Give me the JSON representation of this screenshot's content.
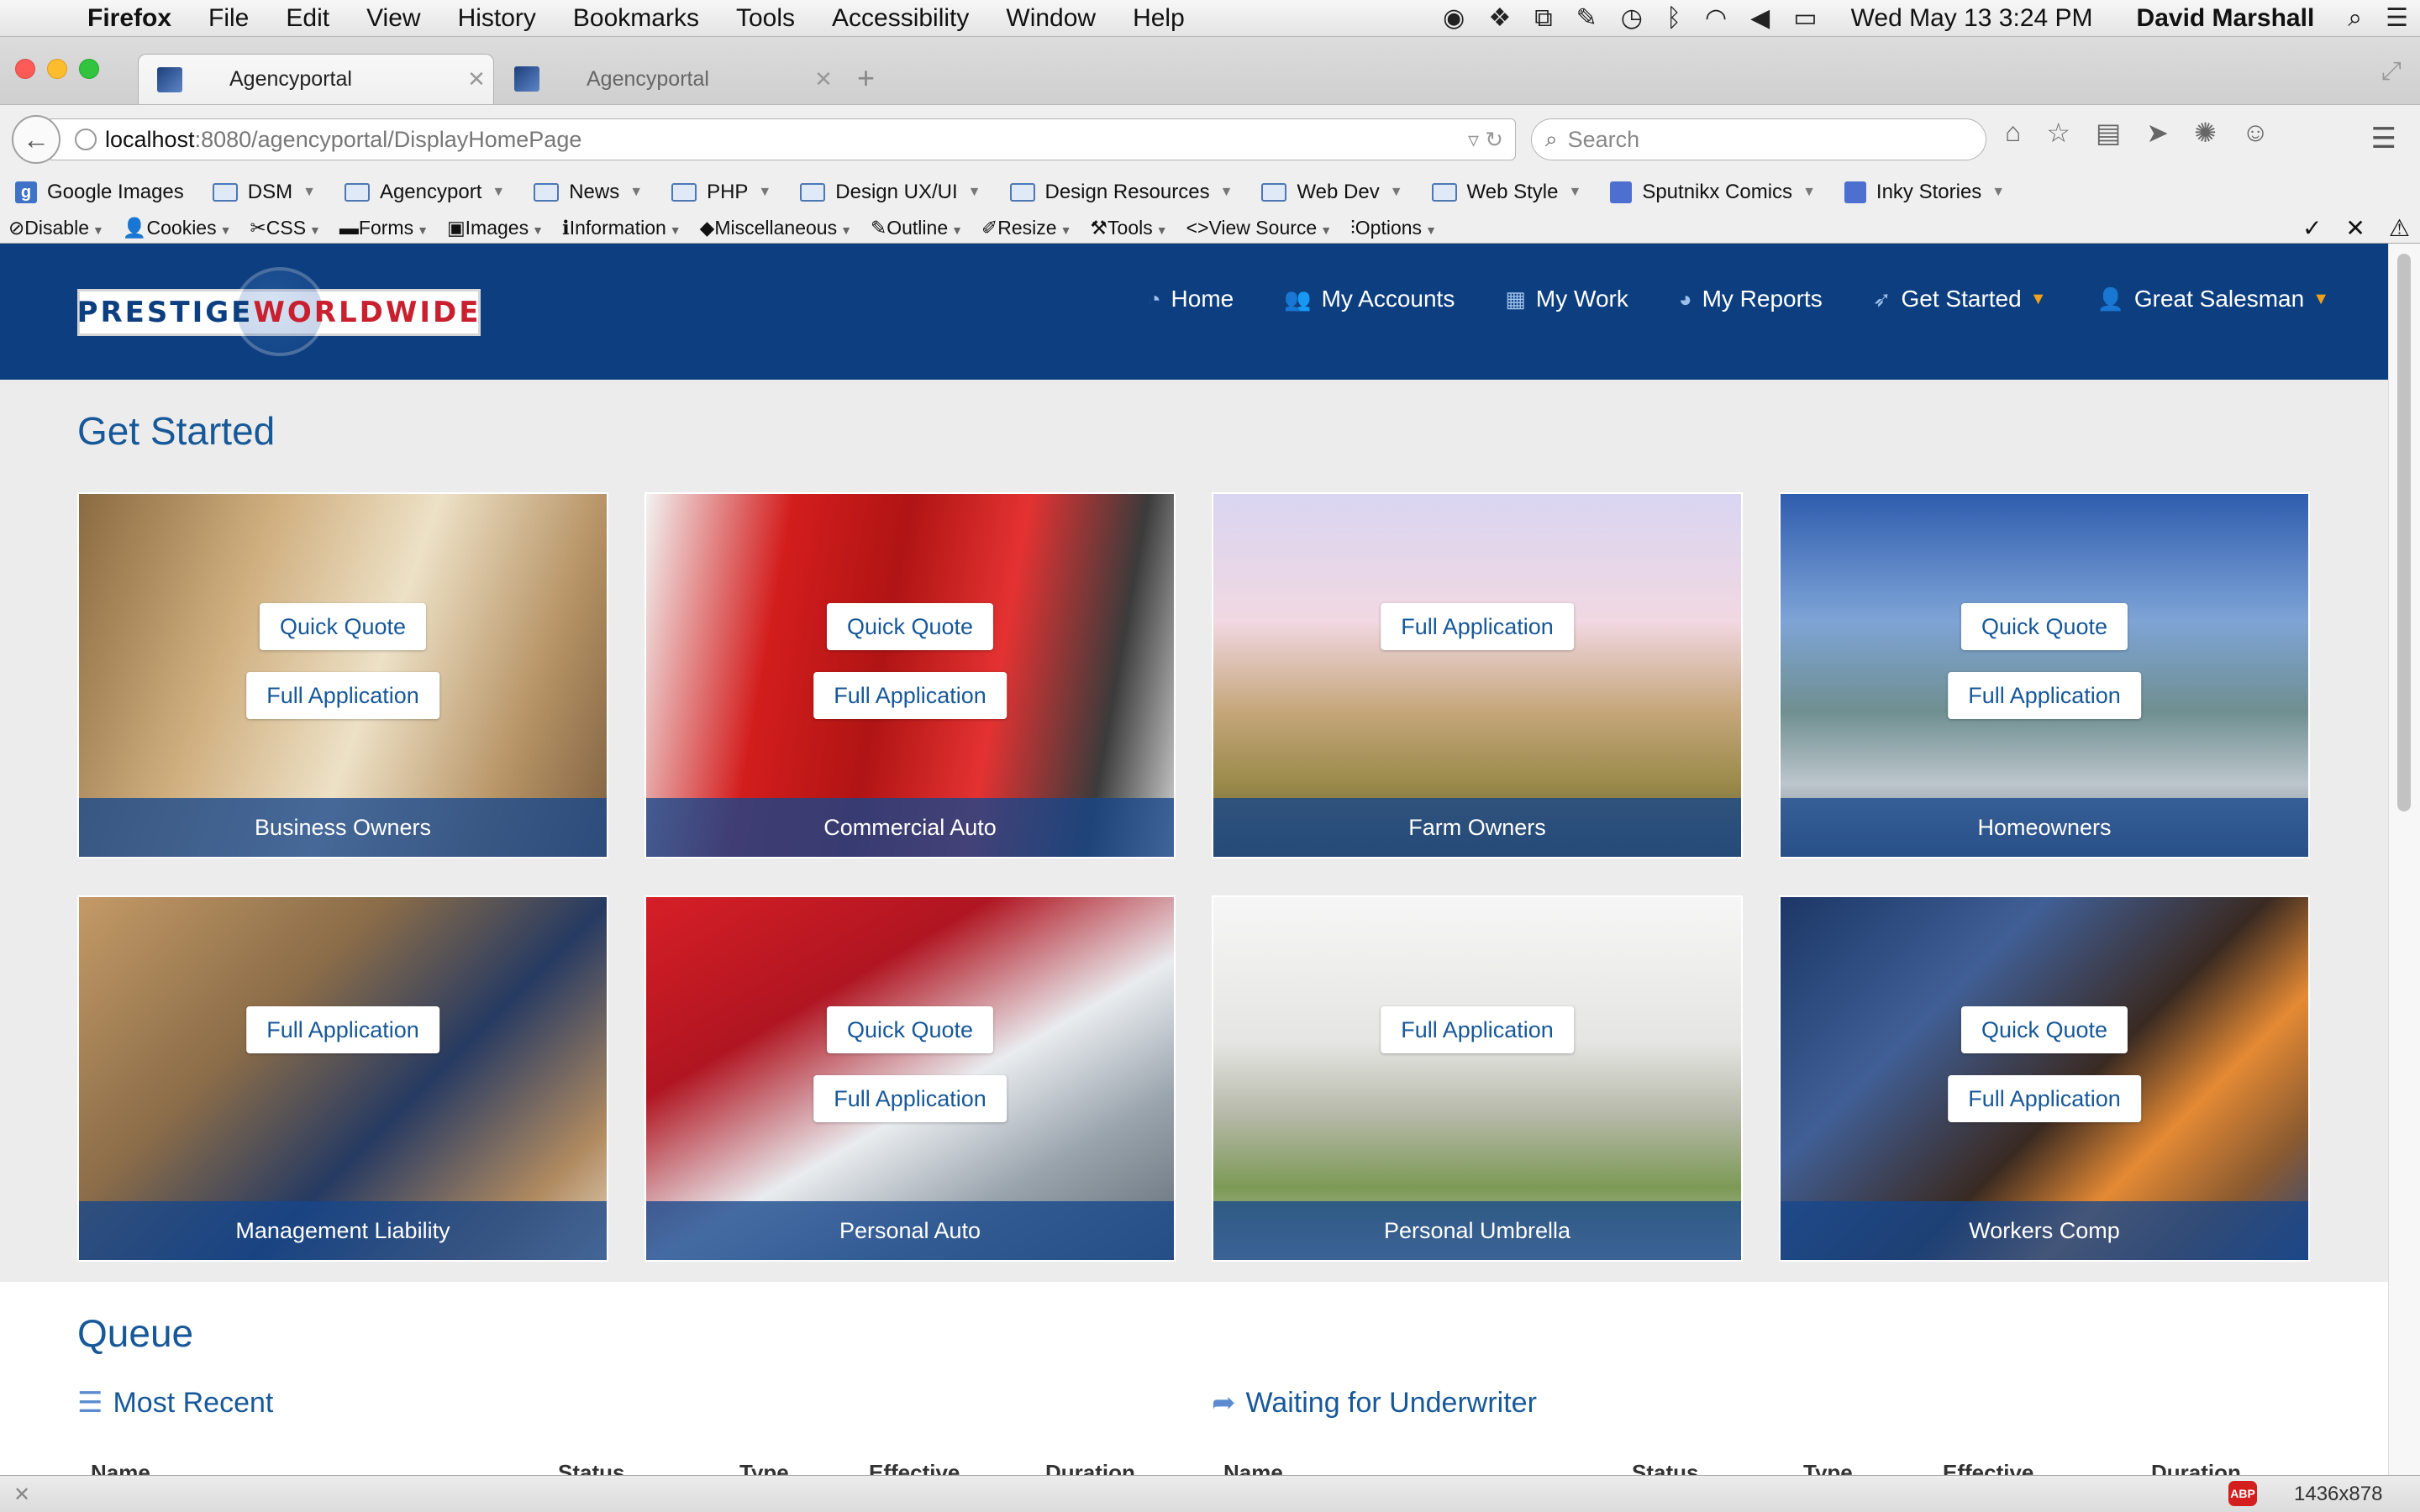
{
  "menubar": {
    "app": "Firefox",
    "items": [
      "File",
      "Edit",
      "View",
      "History",
      "Bookmarks",
      "Tools",
      "Accessibility",
      "Window",
      "Help"
    ],
    "clock": "Wed May 13  3:24 PM",
    "user": "David Marshall"
  },
  "tabs": [
    {
      "title": "Agencyportal",
      "active": true
    },
    {
      "title": "Agencyportal",
      "active": false
    }
  ],
  "navbar": {
    "url_host": "localhost",
    "url_path": ":8080/agencyportal/DisplayHomePage",
    "search_placeholder": "Search"
  },
  "bookmarks": [
    {
      "label": "Google Images",
      "icon": "google-icon",
      "dropdown": false
    },
    {
      "label": "DSM",
      "icon": "folder-icon",
      "dropdown": true
    },
    {
      "label": "Agencyport",
      "icon": "folder-icon",
      "dropdown": true
    },
    {
      "label": "News",
      "icon": "folder-icon",
      "dropdown": true
    },
    {
      "label": "PHP",
      "icon": "folder-icon",
      "dropdown": true
    },
    {
      "label": "Design UX/UI",
      "icon": "folder-icon",
      "dropdown": true
    },
    {
      "label": "Design Resources",
      "icon": "folder-icon",
      "dropdown": true
    },
    {
      "label": "Web Dev",
      "icon": "folder-icon",
      "dropdown": true
    },
    {
      "label": "Web Style",
      "icon": "folder-icon",
      "dropdown": true
    },
    {
      "label": "Sputnikx Comics",
      "icon": "rss-icon",
      "dropdown": true
    },
    {
      "label": "Inky Stories",
      "icon": "rss-icon",
      "dropdown": true
    }
  ],
  "devtoolbar": [
    "Disable",
    "Cookies",
    "CSS",
    "Forms",
    "Images",
    "Information",
    "Miscellaneous",
    "Outline",
    "Resize",
    "Tools",
    "View Source",
    "Options"
  ],
  "site": {
    "logo_word1": "PRESTIGE",
    "logo_word2": "WORLDWIDE",
    "nav": [
      {
        "label": "Home",
        "icon": "dashboard-icon",
        "dropdown": false
      },
      {
        "label": "My Accounts",
        "icon": "users-icon",
        "dropdown": false
      },
      {
        "label": "My Work",
        "icon": "grid-icon",
        "dropdown": false
      },
      {
        "label": "My Reports",
        "icon": "pie-chart-icon",
        "dropdown": false
      },
      {
        "label": "Get Started",
        "icon": "rocket-icon",
        "dropdown": true
      },
      {
        "label": "Great Salesman",
        "icon": "user-icon",
        "dropdown": true
      }
    ]
  },
  "get_started": {
    "title": "Get Started",
    "cards": [
      {
        "caption": "Business Owners",
        "quick_quote": "Quick Quote",
        "full_application": "Full Application"
      },
      {
        "caption": "Commercial Auto",
        "quick_quote": "Quick Quote",
        "full_application": "Full Application"
      },
      {
        "caption": "Farm Owners",
        "quick_quote": null,
        "full_application": "Full Application"
      },
      {
        "caption": "Homeowners",
        "quick_quote": "Quick Quote",
        "full_application": "Full Application"
      },
      {
        "caption": "Management Liability",
        "quick_quote": null,
        "full_application": "Full Application"
      },
      {
        "caption": "Personal Auto",
        "quick_quote": "Quick Quote",
        "full_application": "Full Application"
      },
      {
        "caption": "Personal Umbrella",
        "quick_quote": null,
        "full_application": "Full Application"
      },
      {
        "caption": "Workers Comp",
        "quick_quote": "Quick Quote",
        "full_application": "Full Application"
      }
    ]
  },
  "queue": {
    "title": "Queue",
    "most_recent": {
      "title": "Most Recent",
      "columns": [
        "Name",
        "Status",
        "Type",
        "Effective",
        "Duration"
      ]
    },
    "waiting": {
      "title": "Waiting for Underwriter",
      "columns": [
        "Name",
        "Status",
        "Type",
        "Effective",
        "Duration"
      ]
    }
  },
  "statusbar": {
    "dimensions": "1436x878",
    "adblock": "ABP"
  }
}
